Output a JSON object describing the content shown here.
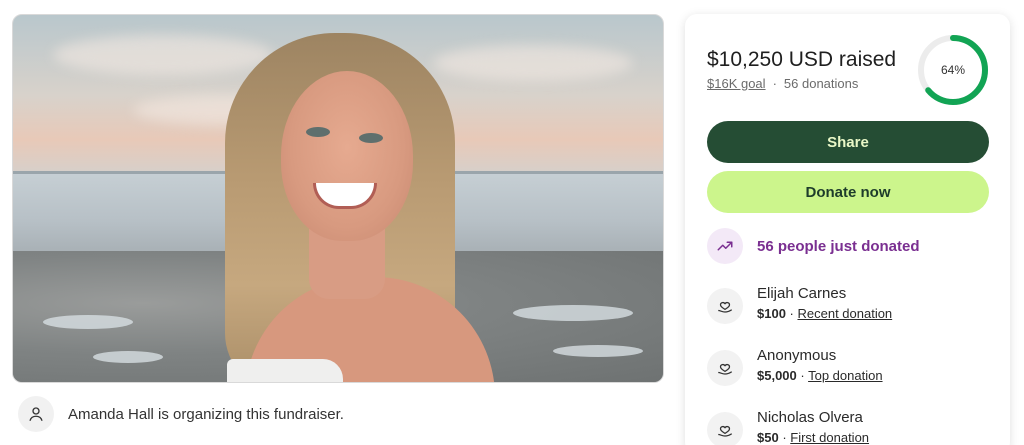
{
  "organizer": {
    "text": "Amanda Hall is organizing this fundraiser.",
    "icon": "person-icon"
  },
  "fundraiser": {
    "raised": "$10,250 USD raised",
    "goal_link": "$16K goal",
    "separator": "·",
    "donations_count": "56 donations",
    "progress_percent": 64,
    "progress_label": "64%",
    "accent_color": "#12a454",
    "track_color": "#ececec"
  },
  "buttons": {
    "share": "Share",
    "donate": "Donate now"
  },
  "trend": {
    "text": "56 people just donated",
    "icon": "trending-up-icon"
  },
  "donors": [
    {
      "name": "Elijah Carnes",
      "amount": "$100",
      "sep": " · ",
      "kind": "Recent donation",
      "icon": "heart-hand-icon"
    },
    {
      "name": "Anonymous",
      "amount": "$5,000",
      "sep": " · ",
      "kind": "Top donation",
      "icon": "heart-hand-icon"
    },
    {
      "name": "Nicholas Olvera",
      "amount": "$50",
      "sep": " · ",
      "kind": "First donation",
      "icon": "heart-hand-icon"
    }
  ]
}
